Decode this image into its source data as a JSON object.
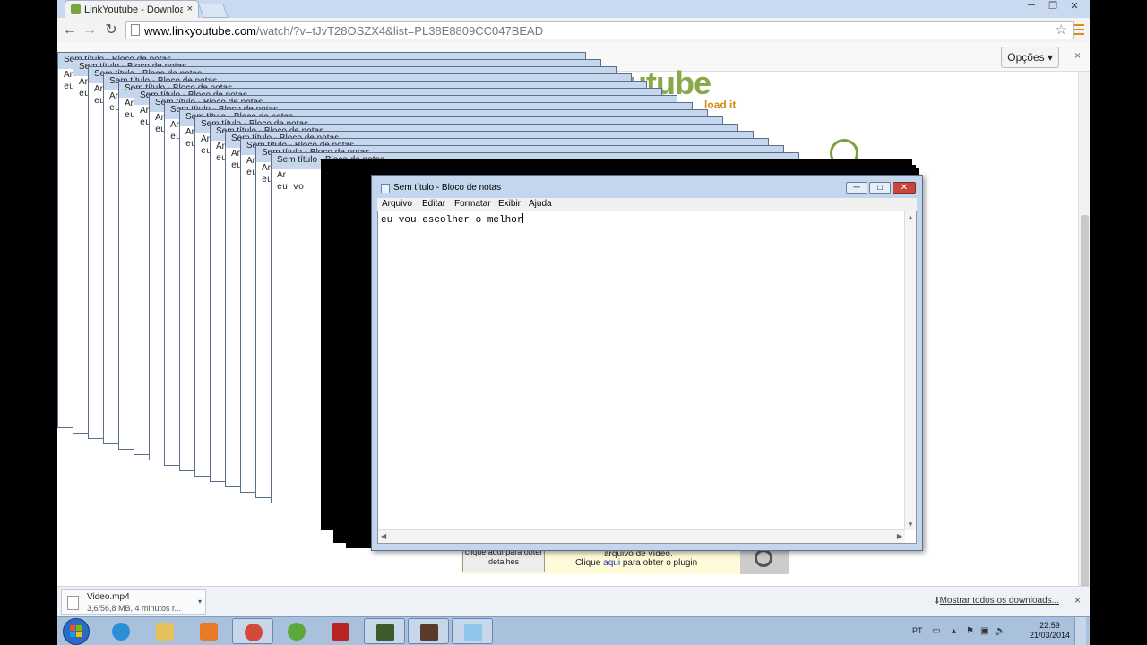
{
  "browser": {
    "tab_title": "LinkYoutube - Download",
    "tab_close": "×",
    "url_host": "www.linkyoutube.com",
    "url_path": "/watch/?v=tJvT28OSZX4&list=PL38E8809CC047BEAD",
    "infobar_options": "Opções",
    "infobar_close": "×",
    "win_minimize": "─",
    "win_restore": "❐",
    "win_close": "✕"
  },
  "page": {
    "logo_text": "utube",
    "logo_sub": "load it",
    "plugin_button": "clique aqui para obter detalhes",
    "plugin_line1": "arquivo de vídeo.",
    "plugin_line2_prefix": "Clique ",
    "plugin_line2_link": "aqui",
    "plugin_line2_suffix": " para obter o plugin"
  },
  "cascade": {
    "title": "Sem título - Bloco de notas",
    "menu_short": "Ar",
    "text_short": "eu vo"
  },
  "notepad": {
    "title": "Sem título - Bloco de notas",
    "menus": [
      "Arquivo",
      "Editar",
      "Formatar",
      "Exibir",
      "Ajuda"
    ],
    "text": "eu vou escolher o melhor",
    "btn_min": "─",
    "btn_max": "□",
    "btn_close": "✕"
  },
  "downloads": {
    "file_name": "Video.mp4",
    "status": "3,6/56,8 MB, 4 minutos r...",
    "show_all": "Mostrar todos os downloads...",
    "close": "×"
  },
  "taskbar": {
    "apps": [
      {
        "name": "internet-explorer-icon",
        "active": false
      },
      {
        "name": "explorer-folder-icon",
        "active": false
      },
      {
        "name": "media-player-icon",
        "active": false
      },
      {
        "name": "chrome-icon",
        "active": true
      },
      {
        "name": "games-icon",
        "active": false
      },
      {
        "name": "app-red-icon",
        "active": false
      },
      {
        "name": "app-dark-icon",
        "active": true
      },
      {
        "name": "app-dark-2-icon",
        "active": true
      },
      {
        "name": "notepad-icon",
        "active": true
      }
    ],
    "language": "PT",
    "time": "22:59",
    "date": "21/03/2014"
  }
}
